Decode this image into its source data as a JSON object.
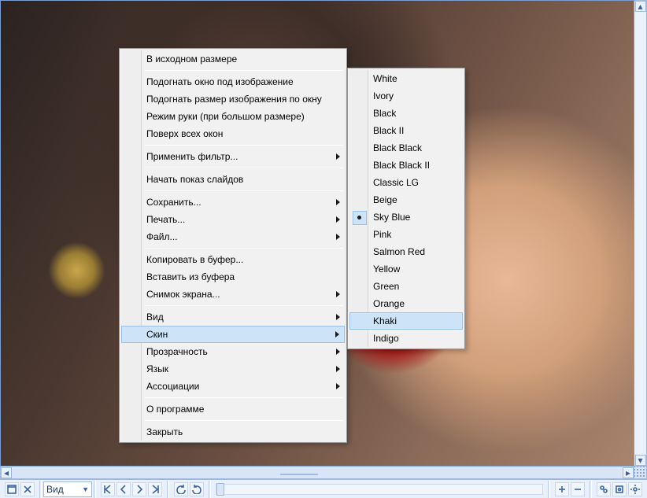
{
  "context_menu": {
    "items": [
      {
        "label": "В исходном размере",
        "submenu": false
      },
      {
        "sep": true
      },
      {
        "label": "Подогнать окно под изображение",
        "submenu": false
      },
      {
        "label": "Подогнать размер изображения по окну",
        "submenu": false
      },
      {
        "label": "Режим руки (при большом размере)",
        "submenu": false
      },
      {
        "label": "Поверх всех окон",
        "submenu": false
      },
      {
        "sep": true
      },
      {
        "label": "Применить фильтр...",
        "submenu": true
      },
      {
        "sep": true
      },
      {
        "label": "Начать показ слайдов",
        "submenu": false
      },
      {
        "sep": true
      },
      {
        "label": "Сохранить...",
        "submenu": true
      },
      {
        "label": "Печать...",
        "submenu": true
      },
      {
        "label": "Файл...",
        "submenu": true
      },
      {
        "sep": true
      },
      {
        "label": "Копировать в буфер...",
        "submenu": false
      },
      {
        "label": "Вставить из буфера",
        "submenu": false
      },
      {
        "label": "Снимок экрана...",
        "submenu": true
      },
      {
        "sep": true
      },
      {
        "label": "Вид",
        "submenu": true
      },
      {
        "label": "Скин",
        "submenu": true,
        "highlight": true
      },
      {
        "label": "Прозрачность",
        "submenu": true
      },
      {
        "label": "Язык",
        "submenu": true
      },
      {
        "label": "Ассоциации",
        "submenu": true
      },
      {
        "sep": true
      },
      {
        "label": "О программе",
        "submenu": false
      },
      {
        "sep": true
      },
      {
        "label": "Закрыть",
        "submenu": false
      }
    ]
  },
  "skin_submenu": {
    "items": [
      {
        "label": "White"
      },
      {
        "label": "Ivory"
      },
      {
        "label": "Black"
      },
      {
        "label": "Black II"
      },
      {
        "label": "Black Black"
      },
      {
        "label": "Black Black II"
      },
      {
        "label": "Classic LG"
      },
      {
        "label": "Beige"
      },
      {
        "label": "Sky Blue",
        "selected": true
      },
      {
        "label": "Pink"
      },
      {
        "label": "Salmon Red"
      },
      {
        "label": "Yellow"
      },
      {
        "label": "Green"
      },
      {
        "label": "Orange"
      },
      {
        "label": "Khaki",
        "hover": true
      },
      {
        "label": "Indigo"
      }
    ]
  },
  "toolbar": {
    "mode_label": "Вид"
  }
}
